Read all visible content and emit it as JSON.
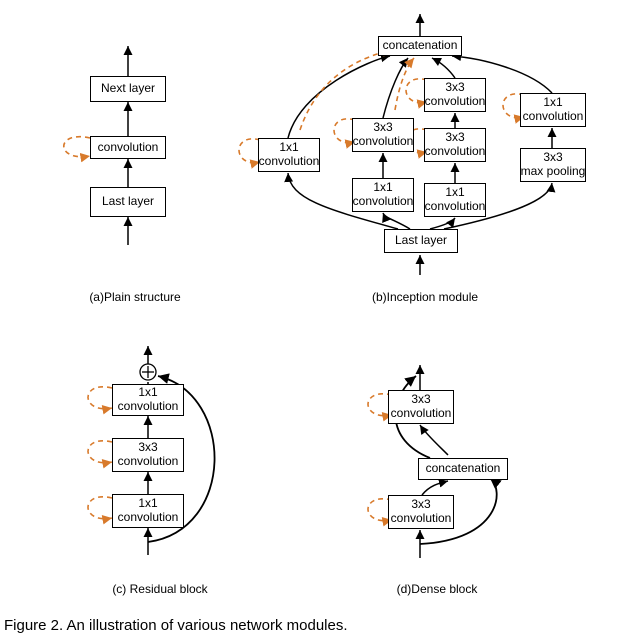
{
  "labels": {
    "concat": "concatenation",
    "conv1x1": "1x1\nconvolution",
    "conv3x3": "3x3\nconvolution",
    "maxpool3x3": "3x3\nmax pooling",
    "convolution": "convolution",
    "lastlayer": "Last layer",
    "nextlayer": "Next layer"
  },
  "captions": {
    "a": "(a)Plain structure",
    "b": "(b)Inception module",
    "c": "(c) Residual block",
    "d": "(d)Dense block",
    "figure": "Figure 2.    An illustration of various network modules."
  },
  "colors": {
    "forward": "#000000",
    "backward": "#d87a2b"
  }
}
